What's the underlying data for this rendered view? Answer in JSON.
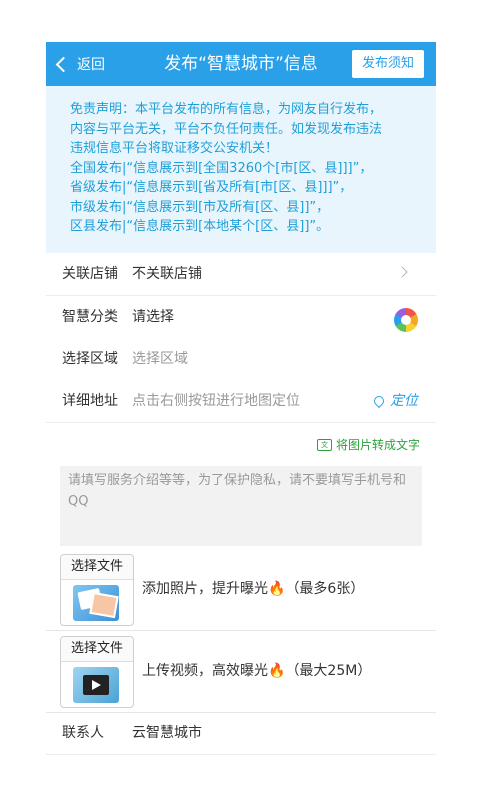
{
  "header": {
    "back_label": "返回",
    "title": "发布“智慧城市”信息",
    "notice_button": "发布须知"
  },
  "disclaimer": [
    "免责声明：本平台发布的所有信息，为网友自行发布，",
    "内容与平台无关，平台不负任何责任。如发现发布违法",
    "违规信息平台将取证移交公安机关！",
    "全国发布|“信息展示到[全国3260个[市[区、县]]]”，",
    "省级发布|“信息展示到[省及所有[市[区、县]]]”，",
    "市级发布|“信息展示到[市及所有[区、县]]”，",
    "区县发布|“信息展示到[本地某个[区、县]]”。"
  ],
  "form": {
    "shop": {
      "label": "关联店铺",
      "value": "不关联店铺"
    },
    "category": {
      "label": "智慧分类",
      "value": "请选择"
    },
    "region": {
      "label": "选择区域",
      "placeholder": "选择区域"
    },
    "address": {
      "label": "详细地址",
      "placeholder": "点击右侧按钮进行地图定位",
      "locate_label": "定位"
    },
    "convert_label": "将图片转成文字",
    "description_placeholder": "请填写服务介绍等等，为了保护隐私，请不要填写手机号和QQ",
    "photo": {
      "button": "选择文件",
      "text": "添加照片，提升曝光",
      "limit": "（最多6张）"
    },
    "video": {
      "button": "选择文件",
      "text": "上传视频，高效曝光",
      "limit": "（最大25M）"
    },
    "contact": {
      "label": "联系人",
      "value": "云智慧城市"
    }
  },
  "colors": {
    "accent": "#2aa0e8",
    "disclaimer_bg": "#e9f5fc",
    "convert": "#27a33b"
  }
}
